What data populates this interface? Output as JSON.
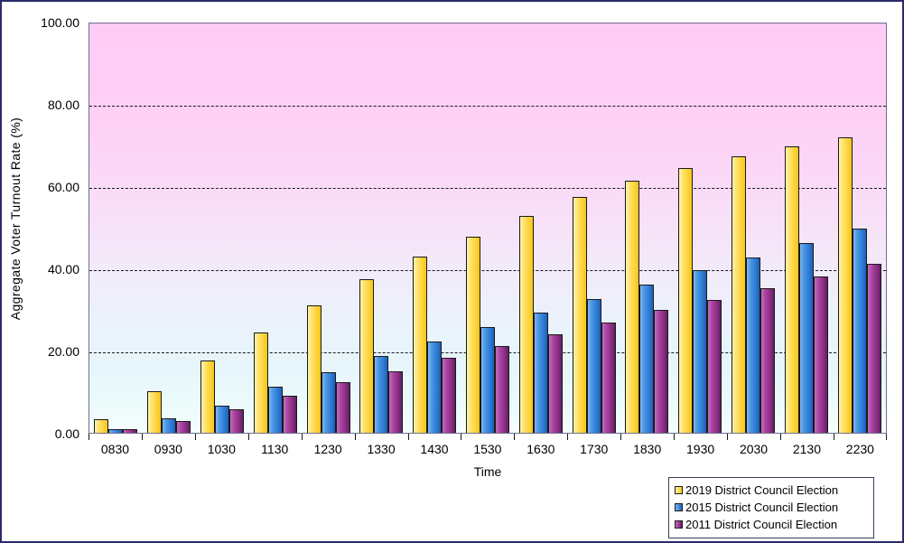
{
  "chart_data": {
    "type": "bar",
    "title": "",
    "xlabel": "Time",
    "ylabel": "Aggregate Voter Turnout Rate (%)",
    "ylim": [
      0,
      100
    ],
    "ytick_labels": [
      "0.00",
      "20.00",
      "40.00",
      "60.00",
      "80.00",
      "100.00"
    ],
    "ytick_values": [
      0,
      20,
      40,
      60,
      80,
      100
    ],
    "grid": true,
    "grid_axis": "y",
    "grid_style": "dashed",
    "legend_position": "bottom-right",
    "categories": [
      "0830",
      "0930",
      "1030",
      "1130",
      "1230",
      "1330",
      "1430",
      "1530",
      "1630",
      "1730",
      "1830",
      "1930",
      "2030",
      "2130",
      "2230"
    ],
    "series": [
      {
        "name": "2019 District Council Election",
        "color": "#ffd743",
        "values": [
          3.3,
          10.2,
          17.5,
          24.4,
          31.0,
          37.4,
          42.8,
          47.7,
          52.8,
          57.4,
          61.3,
          64.4,
          67.2,
          69.7,
          71.9
        ]
      },
      {
        "name": "2015 District Council Election",
        "color": "#2f7fd6",
        "values": [
          0.8,
          3.5,
          6.6,
          11.2,
          14.8,
          18.6,
          22.1,
          25.7,
          29.2,
          32.6,
          36.1,
          39.5,
          42.7,
          46.2,
          49.7
        ]
      },
      {
        "name": "2011 District Council Election",
        "color": "#8e2d84",
        "values": [
          0.9,
          2.9,
          5.8,
          9.1,
          12.3,
          15.0,
          18.2,
          21.0,
          24.0,
          26.8,
          29.9,
          32.4,
          35.1,
          38.0,
          41.1
        ]
      }
    ]
  },
  "legend": {
    "items": [
      {
        "label": "2019 District Council Election",
        "swatch": "s2019"
      },
      {
        "label": "2015 District Council Election",
        "swatch": "s2015"
      },
      {
        "label": "2011 District Council Election",
        "swatch": "s2011"
      }
    ]
  },
  "colors": {
    "series_2019": "#ffd743",
    "series_2015": "#2f7fd6",
    "series_2011": "#8e2d84",
    "plot_bg_top": "#ffccf5",
    "plot_bg_bottom": "#f6feff",
    "frame_border": "#2b2b6b"
  }
}
